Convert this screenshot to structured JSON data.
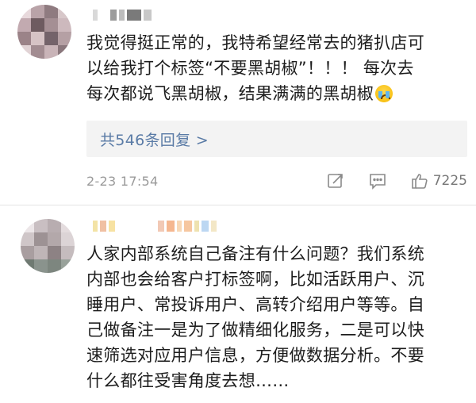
{
  "comments": [
    {
      "text_lines": [
        "我觉得挺正常的，我特希望经常去的猪扒店可",
        "以给我打个标签“不要黑胡椒”！！！ 每次去",
        "每次都说飞黑胡椒，结果满满的黑胡椒"
      ],
      "emoji": "crying-face",
      "replies_label": "共546条回复 >",
      "timestamp": "2-23 17:54",
      "like_count": "7225"
    },
    {
      "text_lines": [
        "人家内部系统自己备注有什么问题？我们系统",
        "内部也会给客户打标签啊，比如活跃用户、沉",
        "睡用户、常投诉用户、高转介绍用户等等。自",
        "己做备注一是为了做精细化服务，二是可以快",
        "速筛选对应用户信息，方便做数据分析。不要",
        "什么都往受害角度去想……"
      ]
    }
  ],
  "colors": {
    "link": "#5a7ba6",
    "meta": "#9a9a9a",
    "reply_bg": "#f3f3f3"
  }
}
